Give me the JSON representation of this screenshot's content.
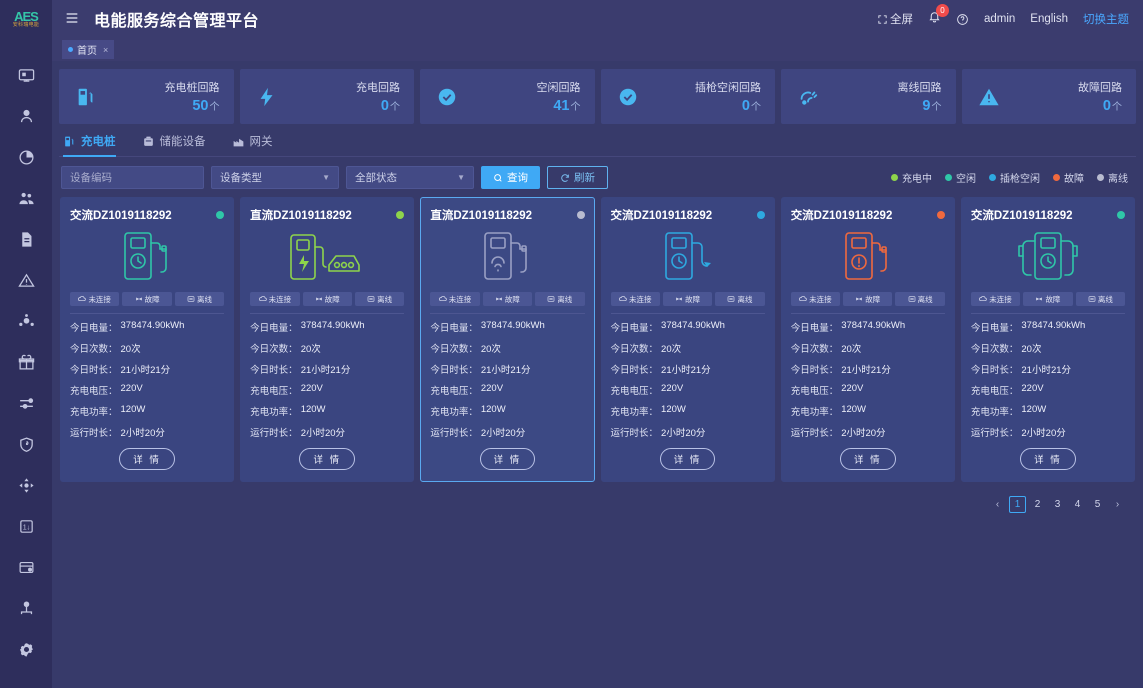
{
  "brand": {
    "mark": "AES",
    "sub": "安科瑞电能"
  },
  "header": {
    "menu_icon": "hamburger-icon",
    "title": "电能服务综合管理平台",
    "fullscreen": "全屏",
    "notification_count": "0",
    "user": "admin",
    "language": "English",
    "theme": "切换主题"
  },
  "page_tag": {
    "label": "首页",
    "close": "×"
  },
  "sidebar": {
    "items": [
      {
        "name": "sidebar-item-monitor",
        "icon": "monitor-icon"
      },
      {
        "name": "sidebar-item-user",
        "icon": "person-icon"
      },
      {
        "name": "sidebar-item-statistics",
        "icon": "pie-chart-icon"
      },
      {
        "name": "sidebar-item-group",
        "icon": "users-icon"
      },
      {
        "name": "sidebar-item-report",
        "icon": "document-icon"
      },
      {
        "name": "sidebar-item-alarm",
        "icon": "warning-triangle-icon"
      },
      {
        "name": "sidebar-item-device",
        "icon": "gear-node-icon"
      },
      {
        "name": "sidebar-item-gift",
        "icon": "gift-icon"
      },
      {
        "name": "sidebar-item-config",
        "icon": "sliders-icon"
      },
      {
        "name": "sidebar-item-security",
        "icon": "shield-icon"
      },
      {
        "name": "sidebar-item-topology",
        "icon": "move-icon"
      },
      {
        "name": "sidebar-item-meter",
        "icon": "meter-icon"
      },
      {
        "name": "sidebar-item-billing",
        "icon": "card-icon"
      },
      {
        "name": "sidebar-item-org",
        "icon": "org-tree-icon"
      },
      {
        "name": "sidebar-item-settings",
        "icon": "gear-icon"
      }
    ]
  },
  "stats": [
    {
      "label": "充电桩回路",
      "value": "50",
      "unit": "个",
      "icon": "charging-pile-icon"
    },
    {
      "label": "充电回路",
      "value": "0",
      "unit": "个",
      "icon": "bolt-icon"
    },
    {
      "label": "空闲回路",
      "value": "41",
      "unit": "个",
      "icon": "check-circle-icon"
    },
    {
      "label": "插枪空闲回路",
      "value": "0",
      "unit": "个",
      "icon": "check-circle-icon"
    },
    {
      "label": "离线回路",
      "value": "9",
      "unit": "个",
      "icon": "offline-icon"
    },
    {
      "label": "故障回路",
      "value": "0",
      "unit": "个",
      "icon": "warning-triangle-icon"
    }
  ],
  "tabs": [
    {
      "label": "充电桩",
      "icon": "charging-pile-icon",
      "active": true
    },
    {
      "label": "储能设备",
      "icon": "battery-icon",
      "active": false
    },
    {
      "label": "网关",
      "icon": "gateway-icon",
      "active": false
    }
  ],
  "filters": {
    "device_code_placeholder": "设备编码",
    "device_code_value": "",
    "device_type": "设备类型",
    "status": "全部状态",
    "search_button": "查询",
    "refresh_button": "刷新"
  },
  "legend": [
    {
      "label": "充电中",
      "color": "#8ed44b"
    },
    {
      "label": "空闲",
      "color": "#2fc7a8"
    },
    {
      "label": "插枪空闲",
      "color": "#2ea9e0"
    },
    {
      "label": "故障",
      "color": "#f0693e"
    },
    {
      "label": "离线",
      "color": "#b9bcd0"
    }
  ],
  "card_field_labels": {
    "energy": "今日电量：",
    "times": "今日次数：",
    "duration": "今日时长：",
    "voltage": "充电电压：",
    "power": "充电功率：",
    "runtime": "运行时长："
  },
  "card_tags": [
    {
      "label": "未连接",
      "icon": "cloud-off-icon"
    },
    {
      "label": "故障",
      "icon": "wrench-icon"
    },
    {
      "label": "离线",
      "icon": "offline-square-icon"
    }
  ],
  "detail_button": "详 情",
  "cards": [
    {
      "title": "交流DZ1019118292",
      "status_color": "#2fc7a8",
      "art": "ac-pile-clock",
      "art_color": "#2fc7a8",
      "selected": false,
      "energy": "378474.90kWh",
      "times": "20次",
      "duration": "21小时21分",
      "voltage": "220V",
      "power": "120W",
      "runtime": "2小时20分"
    },
    {
      "title": "直流DZ1019118292",
      "status_color": "#8ed44b",
      "art": "dc-pile-car",
      "art_color": "#8ed44b",
      "selected": false,
      "energy": "378474.90kWh",
      "times": "20次",
      "duration": "21小时21分",
      "voltage": "220V",
      "power": "120W",
      "runtime": "2小时20分"
    },
    {
      "title": "直流DZ1019118292",
      "status_color": "#b9bcd0",
      "art": "dc-pile-offline",
      "art_color": "#9aa0c4",
      "selected": true,
      "energy": "378474.90kWh",
      "times": "20次",
      "duration": "21小时21分",
      "voltage": "220V",
      "power": "120W",
      "runtime": "2小时20分"
    },
    {
      "title": "交流DZ1019118292",
      "status_color": "#2ea9e0",
      "art": "ac-pile-plugged",
      "art_color": "#2ea9e0",
      "selected": false,
      "energy": "378474.90kWh",
      "times": "20次",
      "duration": "21小时21分",
      "voltage": "220V",
      "power": "120W",
      "runtime": "2小时20分"
    },
    {
      "title": "交流DZ1019118292",
      "status_color": "#f0693e",
      "art": "ac-pile-fault",
      "art_color": "#f0693e",
      "selected": false,
      "energy": "378474.90kWh",
      "times": "20次",
      "duration": "21小时21分",
      "voltage": "220V",
      "power": "120W",
      "runtime": "2小时20分"
    },
    {
      "title": "交流DZ1019118292",
      "status_color": "#2fc7a8",
      "art": "ac-pile-dual",
      "art_color": "#2fc7a8",
      "selected": false,
      "energy": "378474.90kWh",
      "times": "20次",
      "duration": "21小时21分",
      "voltage": "220V",
      "power": "120W",
      "runtime": "2小时20分"
    }
  ],
  "pagination": {
    "prev": "‹",
    "next": "›",
    "pages": [
      "1",
      "2",
      "3",
      "4",
      "5"
    ],
    "current": "1"
  }
}
